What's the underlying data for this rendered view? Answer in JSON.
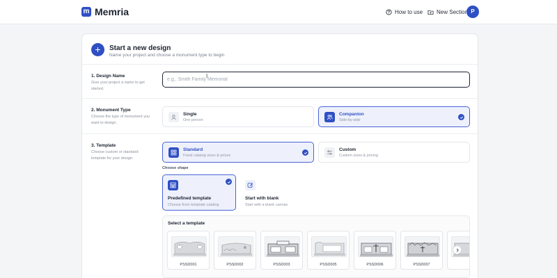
{
  "header": {
    "logo_letter": "m",
    "brand": "Memria",
    "how_to_use": "How to use",
    "new_section": "New Section",
    "avatar_initial": "P"
  },
  "card": {
    "title": "Start a new design",
    "subtitle": "Name your project and choose a monument type to begin"
  },
  "design_name": {
    "label": "1. Design Name",
    "description": "Give your project a name to get started.",
    "value": "",
    "placeholder": "e.g., Smith Family Memorial"
  },
  "monument_type": {
    "label": "2. Monument Type",
    "description": "Choose the type of monument you want to design.",
    "options": [
      {
        "title": "Single",
        "sub": "One person",
        "selected": false
      },
      {
        "title": "Companion",
        "sub": "Side-by-side",
        "selected": true
      }
    ]
  },
  "template": {
    "label": "3. Template",
    "description": "Choose custom or standard template for your design.",
    "options": [
      {
        "title": "Standard",
        "sub": "Fixed catalog sizes & prices",
        "selected": true
      },
      {
        "title": "Custom",
        "sub": "Custom sizes & pricing",
        "selected": false
      }
    ],
    "choose_shape": "Choose shape",
    "shapes": [
      {
        "title": "Predefined template",
        "sub": "Choose from template catalog",
        "selected": true
      },
      {
        "title": "Start with blank",
        "sub": "Start with a blank canvas",
        "selected": false
      }
    ],
    "select_title": "Select a template",
    "tiles": [
      "PSSD001",
      "PSSD002",
      "PSSD003",
      "PSSD005",
      "PSSD006",
      "PSSD007"
    ]
  },
  "colors": {
    "accent": "#2f4fc4",
    "selected_bg": "#eef1fc",
    "selected_border": "#4863d6"
  }
}
